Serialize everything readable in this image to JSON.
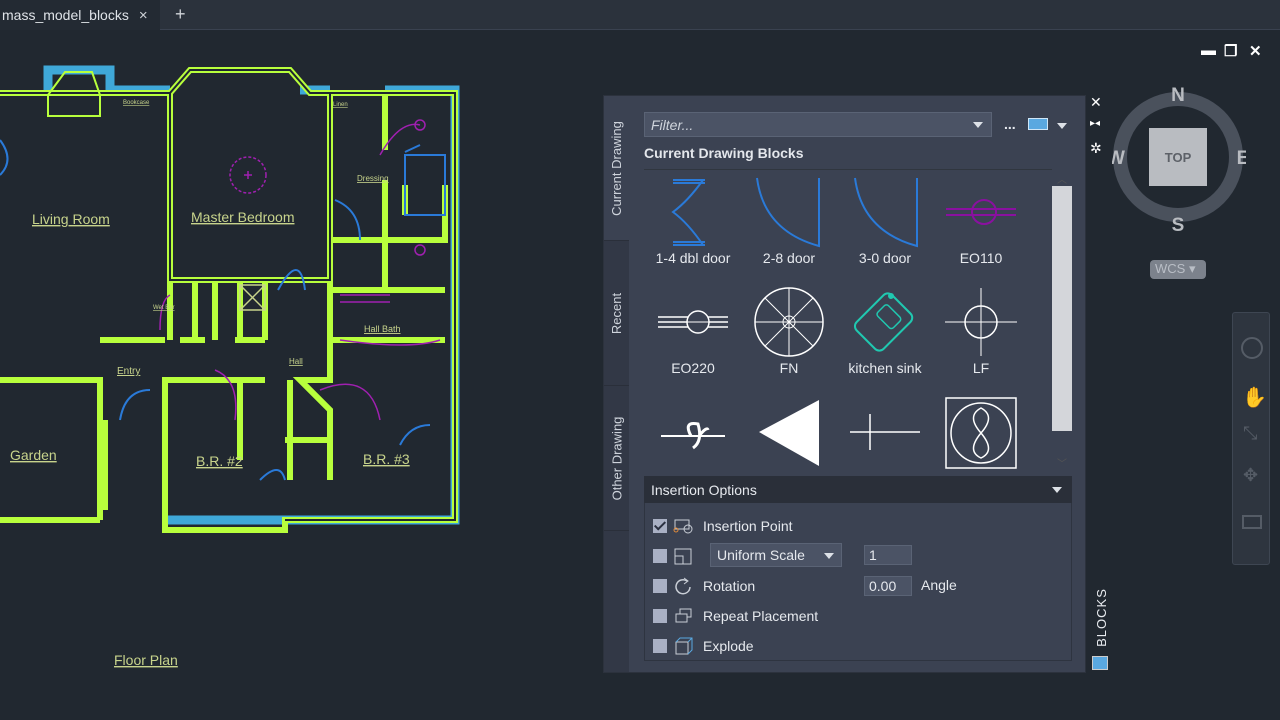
{
  "tabs": {
    "document": "mass_model_blocks",
    "close": "×",
    "new": "+"
  },
  "window_controls": {
    "minimize": "▬",
    "restore": "❐",
    "close": "✕"
  },
  "drawing": {
    "rooms": [
      "Living Room",
      "Master Bedroom",
      "Garden",
      "B.R. #2",
      "B.R. #3",
      "Entry",
      "Hall",
      "Hall Bath",
      "Dressing",
      "Bookcase",
      "Linen",
      "Wet Bar"
    ],
    "title": "Floor Plan",
    "colors": {
      "walls": "#b8ff3c",
      "hatch": "#3fa8d8",
      "fixtures": "#a020b0",
      "doors": "#2a7ad8",
      "text": "#c8d48c"
    }
  },
  "palette": {
    "side_tabs": [
      "Current Drawing",
      "Recent",
      "Other Drawing"
    ],
    "filter_placeholder": "Filter...",
    "more": "...",
    "section_title": "Current Drawing Blocks",
    "blocks": [
      {
        "label": "1-4 dbl door"
      },
      {
        "label": "2-8 door"
      },
      {
        "label": "3-0 door"
      },
      {
        "label": "EO110"
      },
      {
        "label": "EO220"
      },
      {
        "label": "FN"
      },
      {
        "label": "kitchen sink"
      },
      {
        "label": "LF"
      },
      {
        "label": ""
      },
      {
        "label": ""
      },
      {
        "label": ""
      },
      {
        "label": ""
      }
    ],
    "insertion_options": {
      "title": "Insertion Options",
      "insertion_point": {
        "label": "Insertion Point",
        "checked": true
      },
      "scale": {
        "mode": "Uniform Scale",
        "value": "1",
        "checked": false
      },
      "rotation": {
        "label": "Rotation",
        "value": "0.00",
        "unit_label": "Angle",
        "checked": false
      },
      "repeat": {
        "label": "Repeat Placement",
        "checked": false
      },
      "explode": {
        "label": "Explode",
        "checked": false
      }
    },
    "title": "BLOCKS",
    "controls": {
      "close": "✕",
      "autohide": "▸◂",
      "properties": "✲"
    }
  },
  "viewcube": {
    "face": "TOP",
    "n": "N",
    "s": "S",
    "e": "E",
    "w": "W",
    "ucs": "WCS"
  }
}
